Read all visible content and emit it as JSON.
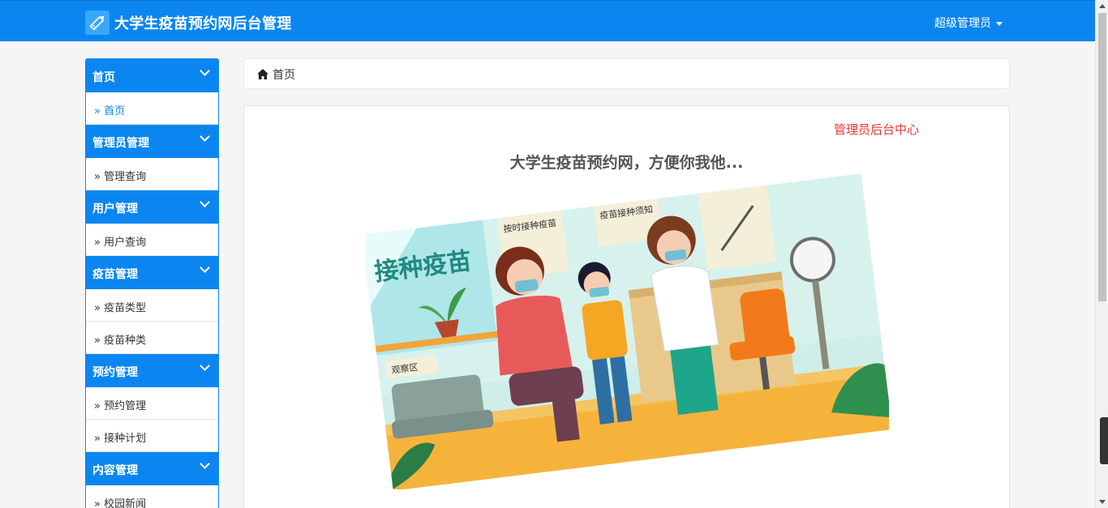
{
  "app": {
    "title": "大学生疫苗预约网后台管理",
    "user_menu": "超级管理员",
    "brand_icon": "pencil-icon",
    "accent": "#0b86f0"
  },
  "sidebar": {
    "groups": [
      {
        "title": "首页",
        "items": [
          "首页"
        ]
      },
      {
        "title": "管理员管理",
        "items": [
          "管理查询"
        ]
      },
      {
        "title": "用户管理",
        "items": [
          "用户查询"
        ]
      },
      {
        "title": "疫苗管理",
        "items": [
          "疫苗类型",
          "疫苗种类"
        ]
      },
      {
        "title": "预约管理",
        "items": [
          "预约管理",
          "接种计划"
        ]
      },
      {
        "title": "内容管理",
        "items": [
          "校园新闻"
        ]
      }
    ],
    "item_prefix": "»"
  },
  "breadcrumb": {
    "home_label": "首页",
    "icon": "home-icon"
  },
  "main": {
    "tag": "管理员后台中心",
    "title": "大学生疫苗预约网，方便你我他...",
    "image_text": {
      "headline": "接种疫苗",
      "poster_left": "按时接种疫苗",
      "poster_mid": "疫苗接种须知",
      "sign": "观察区"
    }
  }
}
